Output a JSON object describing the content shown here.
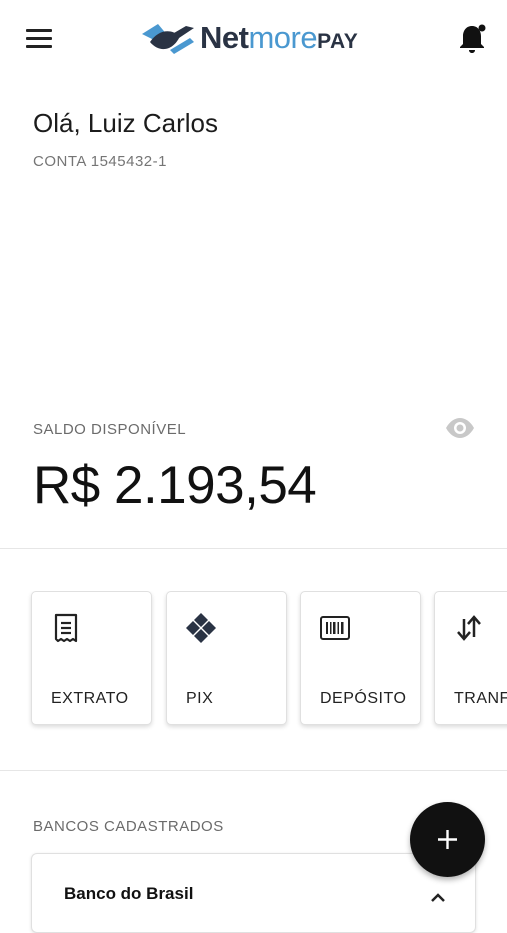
{
  "header": {
    "logo": {
      "word_strong": "Net",
      "word_light": "more",
      "word_suffix": "PAY"
    },
    "icons": {
      "menu": "hamburger-menu-icon",
      "notifications": "bell-icon"
    }
  },
  "user": {
    "greeting": "Olá, Luiz Carlos",
    "account": "CONTA 1545432-1"
  },
  "balance": {
    "label": "SALDO DISPONÍVEL",
    "value": "R$ 2.193,54",
    "visibility_icon": "eye-icon"
  },
  "actions": [
    {
      "label": "EXTRATO",
      "icon": "receipt-icon"
    },
    {
      "label": "PIX",
      "icon": "pix-icon"
    },
    {
      "label": "DEPÓSITO",
      "icon": "barcode-icon"
    },
    {
      "label": "TRANF",
      "icon": "swap-vertical-icon"
    }
  ],
  "banks": {
    "label": "BANCOS CADASTRADOS",
    "items": [
      {
        "name": "Banco do Brasil"
      }
    ]
  },
  "fab": {
    "icon": "plus-icon"
  },
  "colors": {
    "brand_dark": "#2a3344",
    "brand_light": "#4a98d0",
    "text": "#1a1a1a",
    "muted": "#6b6b6b"
  }
}
